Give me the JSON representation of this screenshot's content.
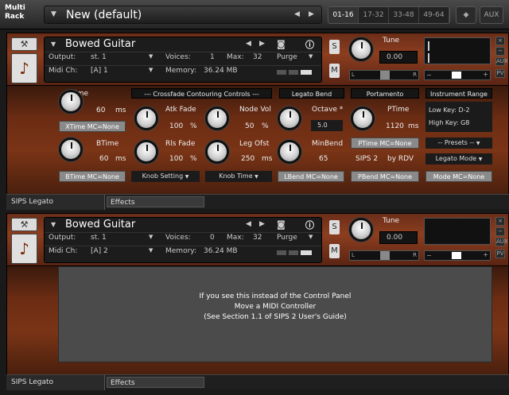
{
  "topbar": {
    "logo_line1": "Multi",
    "logo_line2": "Rack",
    "dropdown_icon": "▼",
    "title": "New (default)",
    "prev": "◀",
    "next": "▶",
    "tabs": [
      "01-16",
      "17-32",
      "33-48",
      "49-64"
    ],
    "settings_icon": "◆",
    "aux": "AUX"
  },
  "instruments": [
    {
      "name": "Bowed Guitar",
      "output_label": "Output:",
      "output": "st. 1",
      "voices_label": "Voices:",
      "voices": "1",
      "max_label": "Max:",
      "max": "32",
      "midi_label": "Midi Ch:",
      "midi": "[A]  1",
      "memory_label": "Memory:",
      "memory": "36.24 MB",
      "purge": "Purge",
      "tune_label": "Tune",
      "tune_value": "0.00",
      "s": "S",
      "m": "M",
      "l": "L",
      "r": "R"
    },
    {
      "name": "Bowed Guitar",
      "output_label": "Output:",
      "output": "st. 1",
      "voices_label": "Voices:",
      "voices": "0",
      "max_label": "Max:",
      "max": "32",
      "midi_label": "Midi Ch:",
      "midi": "[A]  2",
      "memory_label": "Memory:",
      "memory": "36.24 MB",
      "purge": "Purge",
      "tune_label": "Tune",
      "tune_value": "0.00",
      "s": "S",
      "m": "M",
      "l": "L",
      "r": "R"
    }
  ],
  "panel": {
    "xtime_label": "XTime",
    "xtime_value": "60",
    "ms": "ms",
    "xtime_mc": "XTime MC=None",
    "crossfade_header": "--- Crossfade Contouring Controls ---",
    "atk_label": "Atk Fade",
    "atk_value": "100",
    "pct": "%",
    "node_label": "Node Vol",
    "node_value": "50",
    "legato_bend_header": "Legato Bend",
    "octave_label": "Octave *",
    "octave_value": "5.0",
    "portamento_header": "Portamento",
    "ptime_label": "PTime",
    "ptime_value": "1120",
    "ptime_mc": "PTime MC=None",
    "range_header": "Instrument Range",
    "low_key": "Low Key:  D-2",
    "high_key": "High Key:   G8",
    "btime_label": "BTime",
    "btime_value": "60",
    "rls_label": "Rls Fade",
    "rls_value": "100",
    "leg_label": "Leg Ofst",
    "leg_value": "250",
    "minbend_label": "MinBend",
    "minbend_value": "65",
    "presets": "-- Presets --",
    "sips": "SIPS 2",
    "byrdv": "by RDV",
    "btime_mc": "BTime MC=None",
    "knob_setting": "Knob Setting",
    "knob_time": "Knob Time",
    "lbend_mc": "LBend MC=None",
    "pbend_mc": "PBend MC=None",
    "mode_mc": "Mode MC=None",
    "legato_mode": "Legato Mode",
    "caret": "▼"
  },
  "footer": {
    "tab1": "SIPS Legato",
    "tab2": "Effects"
  },
  "message": {
    "line1": "If you see this instead of the Control Panel",
    "line2": "Move a MIDI Controller",
    "line3": "(See Section 1.1 of SIPS 2 User's Guide)"
  }
}
